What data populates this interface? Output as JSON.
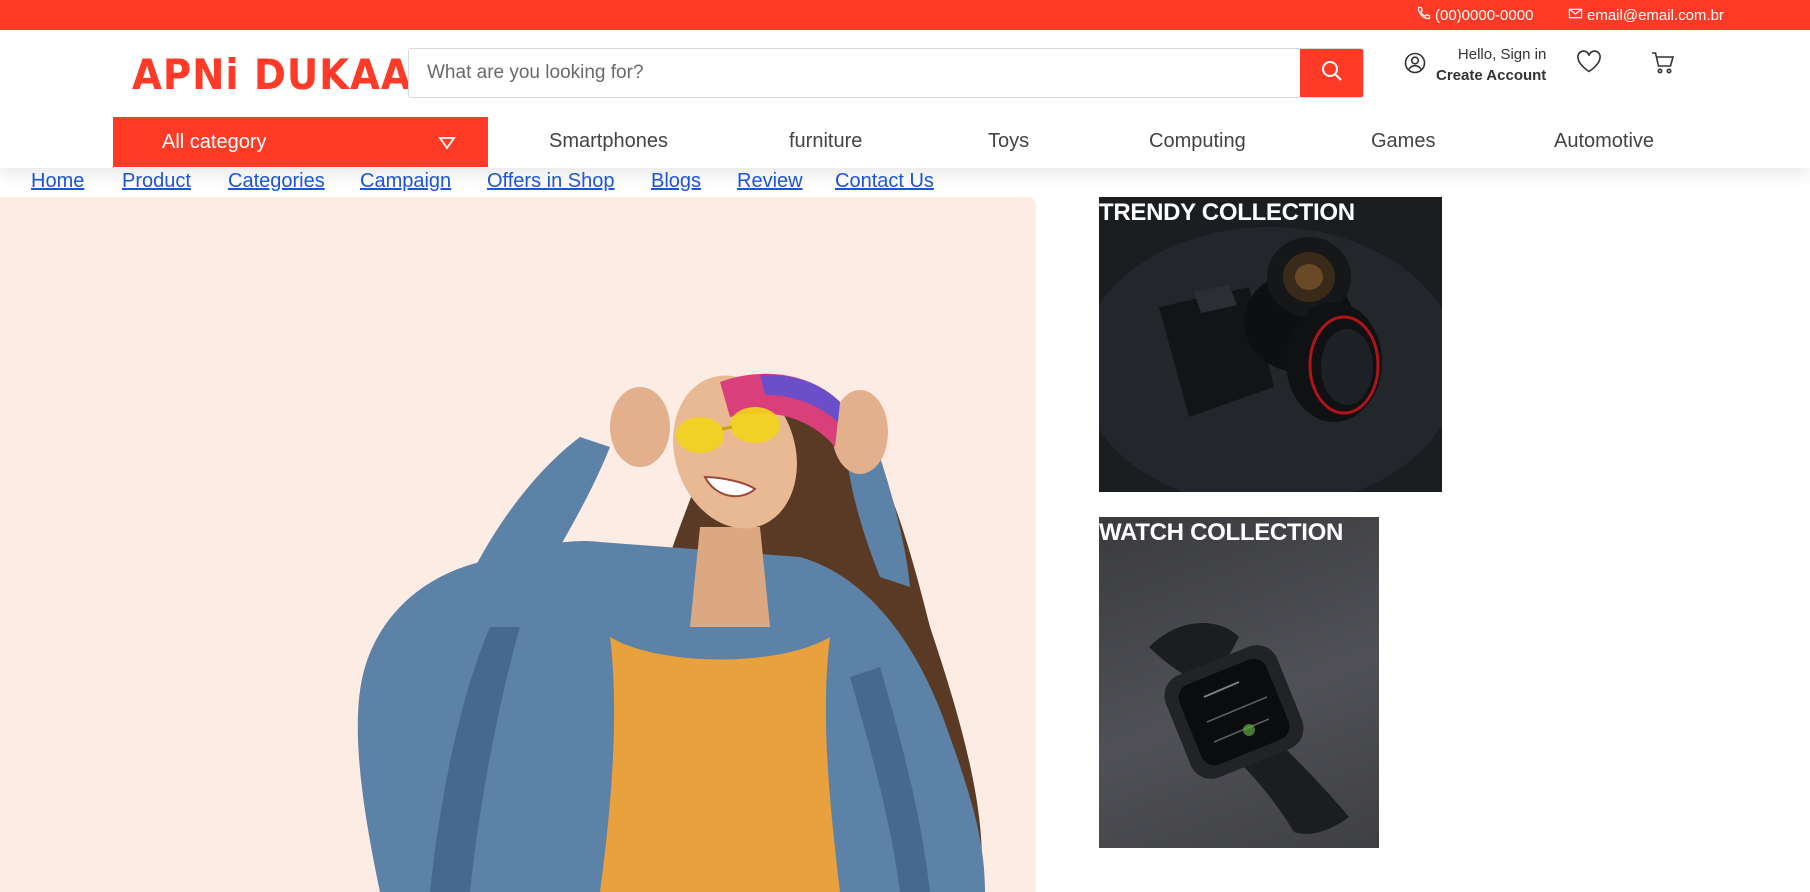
{
  "topbar": {
    "phone": "(00)0000-0000",
    "email": "email@email.com.br",
    "accent_color": "#ff3a26"
  },
  "header": {
    "logo": "APNi DUKAAN",
    "search": {
      "placeholder": "What are you looking for?"
    },
    "account": {
      "hello": "Hello, Sign in",
      "create": "Create Account"
    },
    "icons": [
      "phone-icon",
      "mail-icon",
      "search-icon",
      "user-icon",
      "heart-icon",
      "cart-icon"
    ]
  },
  "categories": {
    "all_label": "All category",
    "items": [
      "Smartphones",
      "furniture",
      "Toys",
      "Computing",
      "Games",
      "Automotive"
    ]
  },
  "nav": {
    "links": [
      "Home",
      "Product",
      "Categories",
      "Campaign",
      "Offers in Shop",
      "Blogs",
      "Review",
      "Contact Us"
    ]
  },
  "collections": {
    "trendy": "TRENDY COLLECTION",
    "watch": "WATCH COLLECTION"
  }
}
